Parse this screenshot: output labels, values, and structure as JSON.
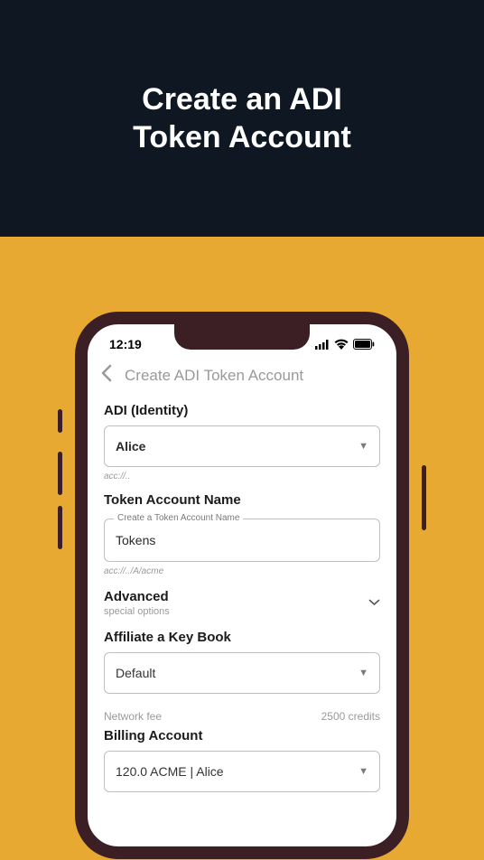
{
  "banner": {
    "title_line1": "Create an ADI",
    "title_line2": "Token Account"
  },
  "status": {
    "time": "12:19"
  },
  "nav": {
    "title": "Create ADI Token Account"
  },
  "adi": {
    "label": "ADI (Identity)",
    "value": "Alice",
    "hint": "acc://.."
  },
  "token_name": {
    "label": "Token Account Name",
    "float_label": "Create a Token Account Name",
    "value": "Tokens",
    "hint": "acc://../A/acme"
  },
  "advanced": {
    "label": "Advanced",
    "sub": "special options"
  },
  "keybook": {
    "label": "Affiliate a Key Book",
    "value": "Default"
  },
  "fee": {
    "label": "Network fee",
    "value": "2500 credits"
  },
  "billing": {
    "label": "Billing Account",
    "value": "120.0 ACME | Alice"
  }
}
